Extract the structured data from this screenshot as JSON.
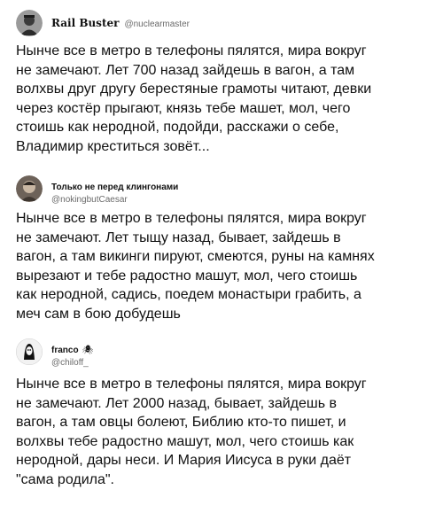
{
  "tweets": [
    {
      "display_name": "Rail Buster",
      "handle": "@nuclearmaster",
      "avatar_icon": "avatar-portrait-icon",
      "text": "Нынче все в метро в телефоны пялятся, мира вокруг\nне замечают. Лет 700 назад зайдешь в вагон, а там\nволхвы друг другу берестяные грамоты читают, девки\nчерез костёр прыгают, князь тебе машет, мол, чего\nстоишь как неродной, подойди, расскажи о себе,\nВладимир креститься зовёт..."
    },
    {
      "display_name": "Только не перед клингонами",
      "handle": "@nokingbutCaesar",
      "avatar_icon": "avatar-photo-icon",
      "text": "Нынче все в метро в телефоны пялятся, мира вокруг\nне замечают. Лет тыщу назад, бывает, зайдешь в\nвагон, а там викинги пируют, смеются, руны на камнях\nвырезают и тебе радостно машут, мол, чего стоишь\nкак неродной, садись, поедем монастыри грабить, а\nмеч сам в бою добудешь"
    },
    {
      "display_name": "franco",
      "handle": "@chiloff_",
      "emoji": "🕷",
      "avatar_icon": "avatar-drawing-icon",
      "text": "Нынче все в метро в телефоны пялятся, мира вокруг\nне замечают. Лет 2000 назад, бывает, зайдешь в\nвагон, а там овцы болеют, Библию кто-то пишет, и\nволхвы тебе радостно машут, мол, чего стоишь как\nнеродной, дары неси. И Мария Иисуса в руки даёт\n\"сама родила\"."
    }
  ]
}
